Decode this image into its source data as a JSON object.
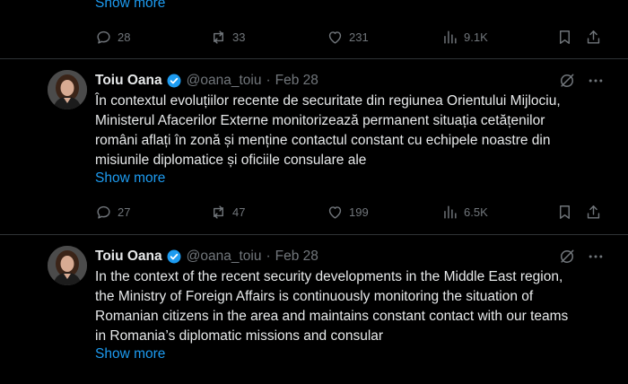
{
  "top_tweet": {
    "show_more": "Show more",
    "replies": "28",
    "reposts": "33",
    "likes": "231",
    "views": "9.1K"
  },
  "tweets": [
    {
      "author": "Toiu Oana",
      "handle": "@oana_toiu",
      "separator": "·",
      "date": "Feb 28",
      "text": "În contextul evoluțiilor recente de securitate din regiunea Orientului Mijlociu,\nMinisterul Afacerilor Externe monitorizează permanent situația cetățenilor\nromâni aflați în zonă și menține contactul constant cu echipele noastre din\nmisiunile diplomatice și oficiile consulare ale",
      "show_more": "Show more",
      "replies": "27",
      "reposts": "47",
      "likes": "199",
      "views": "6.5K"
    },
    {
      "author": "Toiu Oana",
      "handle": "@oana_toiu",
      "separator": "·",
      "date": "Feb 28",
      "text": "In the context of the recent security developments in the Middle East region,\nthe Ministry of Foreign Affairs is continuously monitoring the situation of\nRomanian citizens in the area and maintains constant contact with our teams\nin Romania’s diplomatic missions and consular",
      "show_more": "Show more"
    }
  ],
  "icons": {
    "reply": "reply-icon",
    "repost": "repost-icon",
    "like": "heart-icon",
    "views": "views-icon",
    "bookmark": "bookmark-icon",
    "share": "share-icon",
    "grok": "grok-icon",
    "more": "more-icon",
    "verified": "verified-badge-icon"
  },
  "colors": {
    "background": "#000000",
    "text": "#e7e9ea",
    "muted": "#71767b",
    "link": "#1d9bf0",
    "divider": "#2f3336"
  }
}
